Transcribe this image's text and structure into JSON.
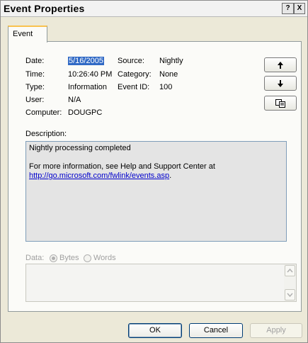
{
  "window": {
    "title": "Event Properties",
    "help_glyph": "?",
    "close_glyph": "X"
  },
  "tabs": [
    {
      "label": "Event"
    }
  ],
  "fields": {
    "date_label": "Date:",
    "date_value": "5/16/2005",
    "source_label": "Source:",
    "source_value": "Nightly",
    "time_label": "Time:",
    "time_value": "10:26:40 PM",
    "category_label": "Category:",
    "category_value": "None",
    "type_label": "Type:",
    "type_value": "Information",
    "event_id_label": "Event ID:",
    "event_id_value": "100",
    "user_label": "User:",
    "user_value": "N/A",
    "computer_label": "Computer:",
    "computer_value": "DOUGPC"
  },
  "side_buttons": [
    {
      "icon": "arrow-up-icon"
    },
    {
      "icon": "arrow-down-icon"
    },
    {
      "icon": "copy-icon"
    }
  ],
  "description": {
    "label": "Description:",
    "line1": "Nightly processing completed",
    "line2": "For more information, see Help and Support Center at",
    "link": "http://go.microsoft.com/fwlink/events.asp",
    "link_suffix": "."
  },
  "data_section": {
    "label": "Data:",
    "bytes_label": "Bytes",
    "words_label": "Words",
    "selected": "Bytes"
  },
  "buttons": {
    "ok": "OK",
    "cancel": "Cancel",
    "apply": "Apply"
  },
  "colors": {
    "selection": "#316ac5",
    "link": "#0000cc",
    "tab_accent": "#f9c24e"
  }
}
